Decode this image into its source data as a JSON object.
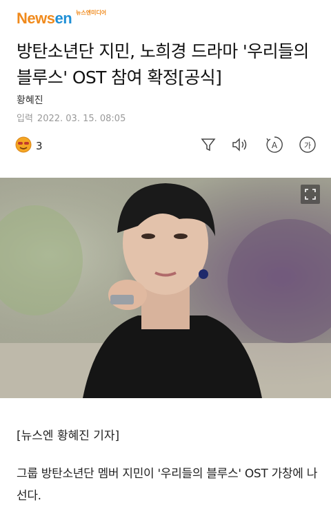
{
  "logo": {
    "part_news": "News",
    "part_en": "en",
    "tagline": "뉴스엔미디어"
  },
  "article": {
    "title": "방탄소년단 지민, 노희경 드라마 '우리들의 블루스' OST 참여 확정[공식]",
    "author": "황혜진",
    "timestamp_label": "입력",
    "timestamp": "2022. 03. 15. 08:05",
    "byline": "[뉴스엔 황혜진 기자]",
    "body": "그룹 방탄소년단 멤버 지민이 '우리들의 블루스' OST 가창에 나선다."
  },
  "toolbar": {
    "reaction_count": "3",
    "icons": [
      "filter-icon",
      "speaker-icon",
      "font-size-icon",
      "translate-icon"
    ],
    "translate_glyph": "가",
    "font_glyph": "A"
  },
  "colors": {
    "logo_orange": "#f08a1c",
    "logo_blue": "#1f8fd6",
    "meta_gray": "#999999"
  }
}
